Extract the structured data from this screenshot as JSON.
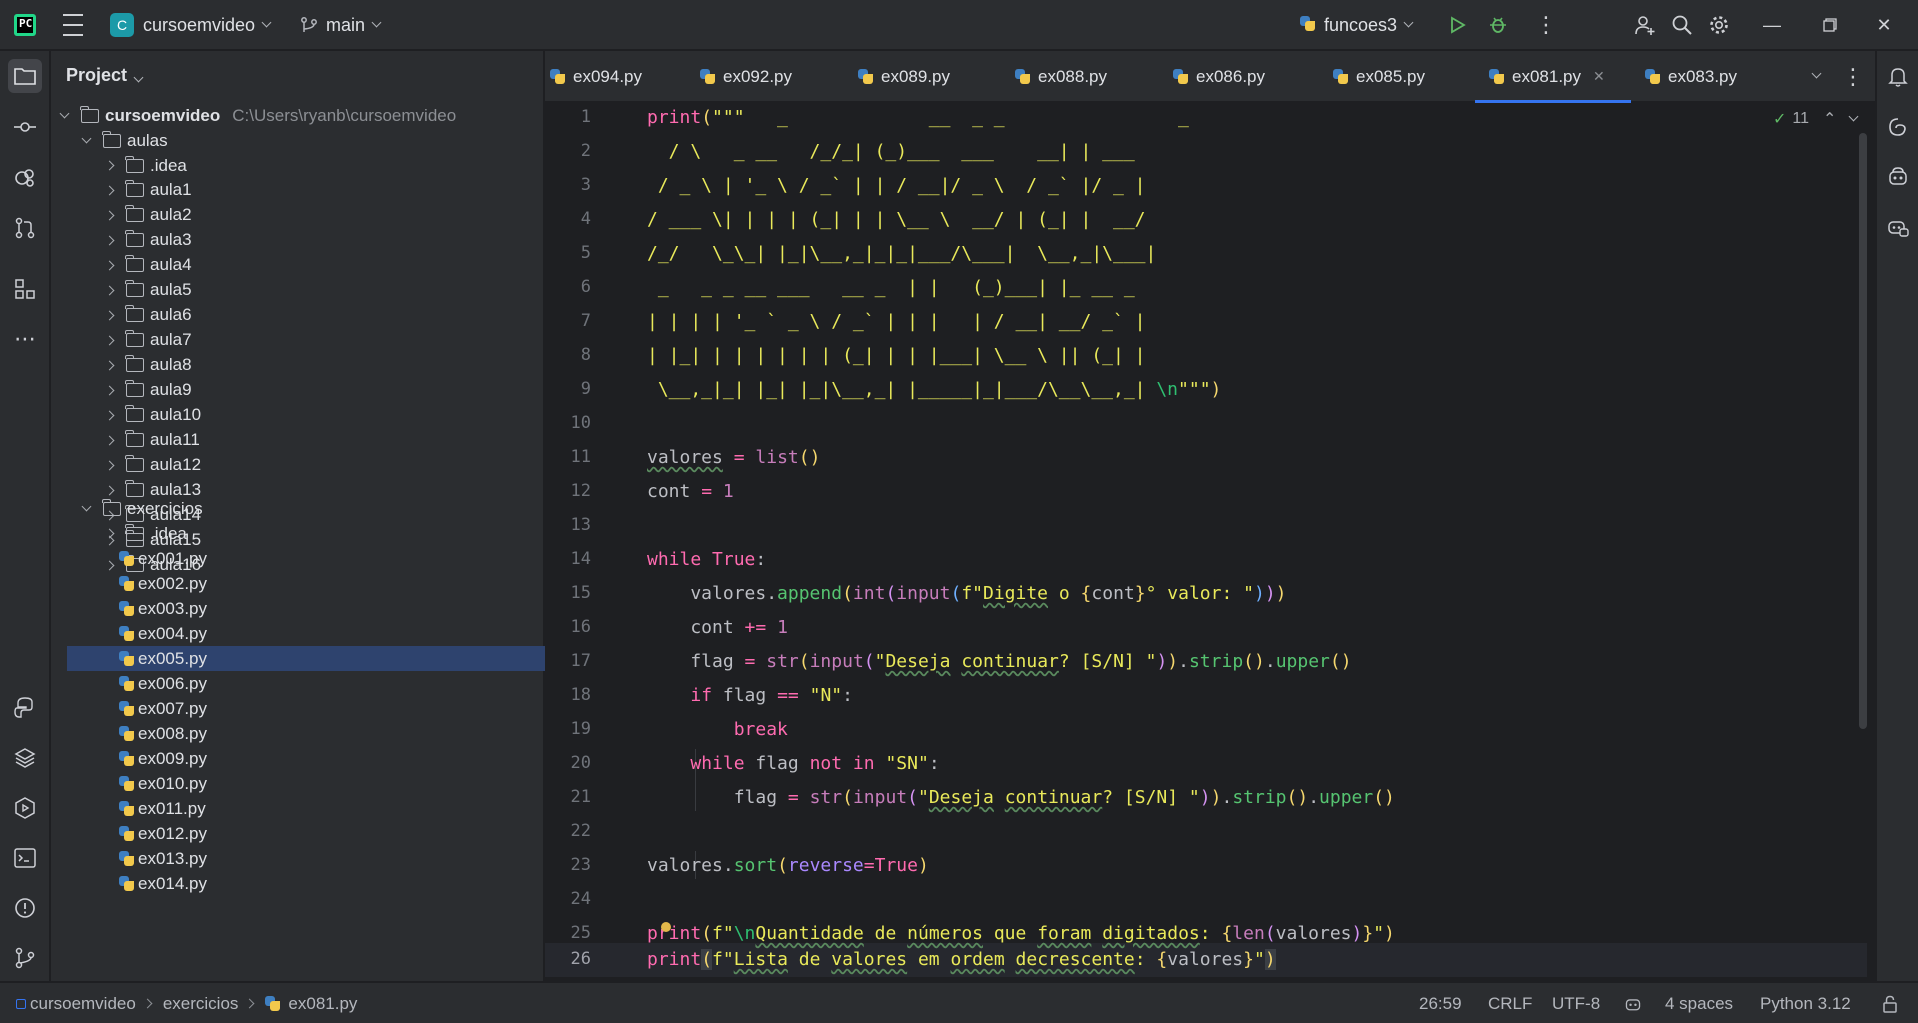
{
  "titlebar": {
    "project_badge": "C",
    "project_name": "cursoemvideo",
    "branch": "main",
    "run_config": "funcoes3"
  },
  "project_panel": {
    "title": "Project",
    "root_name": "cursoemvideo",
    "root_path": "C:\\Users\\ryanb\\cursoemvideo",
    "aulas_folder": "aulas",
    "aulas_children": [
      ".idea",
      "aula1",
      "aula2",
      "aula3",
      "aula4",
      "aula5",
      "aula6",
      "aula7",
      "aula8",
      "aula9",
      "aula10",
      "aula11",
      "aula12",
      "aula13",
      "aula14",
      "aula15",
      "aula16"
    ],
    "exercicios_folder": "exercicios",
    "exercicios_idea": ".idea",
    "exercicios_files": [
      "ex001.py",
      "ex002.py",
      "ex003.py",
      "ex004.py",
      "ex005.py",
      "ex006.py",
      "ex007.py",
      "ex008.py",
      "ex009.py",
      "ex010.py",
      "ex011.py",
      "ex012.py",
      "ex013.py",
      "ex014.py"
    ],
    "selected_file": "ex005.py"
  },
  "tabs": [
    {
      "label": "ex094.py"
    },
    {
      "label": "ex092.py"
    },
    {
      "label": "ex089.py"
    },
    {
      "label": "ex088.py"
    },
    {
      "label": "ex086.py"
    },
    {
      "label": "ex085.py"
    },
    {
      "label": "ex081.py",
      "active": true
    },
    {
      "label": "ex083.py"
    }
  ],
  "editor": {
    "inspection_count": "11",
    "line_numbers": [
      "1",
      "2",
      "3",
      "4",
      "5",
      "6",
      "7",
      "8",
      "9",
      "10",
      "11",
      "12",
      "13",
      "14",
      "15",
      "16",
      "17",
      "18",
      "19",
      "20",
      "21",
      "22",
      "23",
      "24",
      "25",
      "26"
    ],
    "current_line": "26",
    "ascii_art": [
      "   _             __  _ _                _",
      "  / \\   _ __   /_/_| (_)___  ___    __| | ___",
      " / _ \\ | '_ \\ / _` | | / __|/ _ \\  / _` |/ _ |",
      "/ ___ \\| | | | (_| | | \\__ \\  __/ | (_| |  __/",
      "/_/   \\_\\_| |_|\\__,_|_|_|___/\\___|  \\__,_|\\___|",
      " _   _ _ __ ___   __ _  | |   (_)___| |_ __ _",
      "| | | | '_ ` _ \\ / _` | | |   | / __| __/ _` |",
      "| |_| | | | | | | (_| | | |___| \\__ \\ || (_| |",
      " \\__,_|_| |_| |_|\\__,_| |_____|_|___/\\__\\__,_| "
    ]
  },
  "statusbar": {
    "crumb_project": "cursoemvideo",
    "crumb_folder": "exercicios",
    "crumb_file": "ex081.py",
    "position": "26:59",
    "line_sep": "CRLF",
    "encoding": "UTF-8",
    "indent": "4 spaces",
    "interpreter": "Python 3.12"
  },
  "colors": {
    "accent": "#3574f0",
    "selection": "#2e436e",
    "background": "#1e1f22",
    "panel": "#2b2d30"
  }
}
